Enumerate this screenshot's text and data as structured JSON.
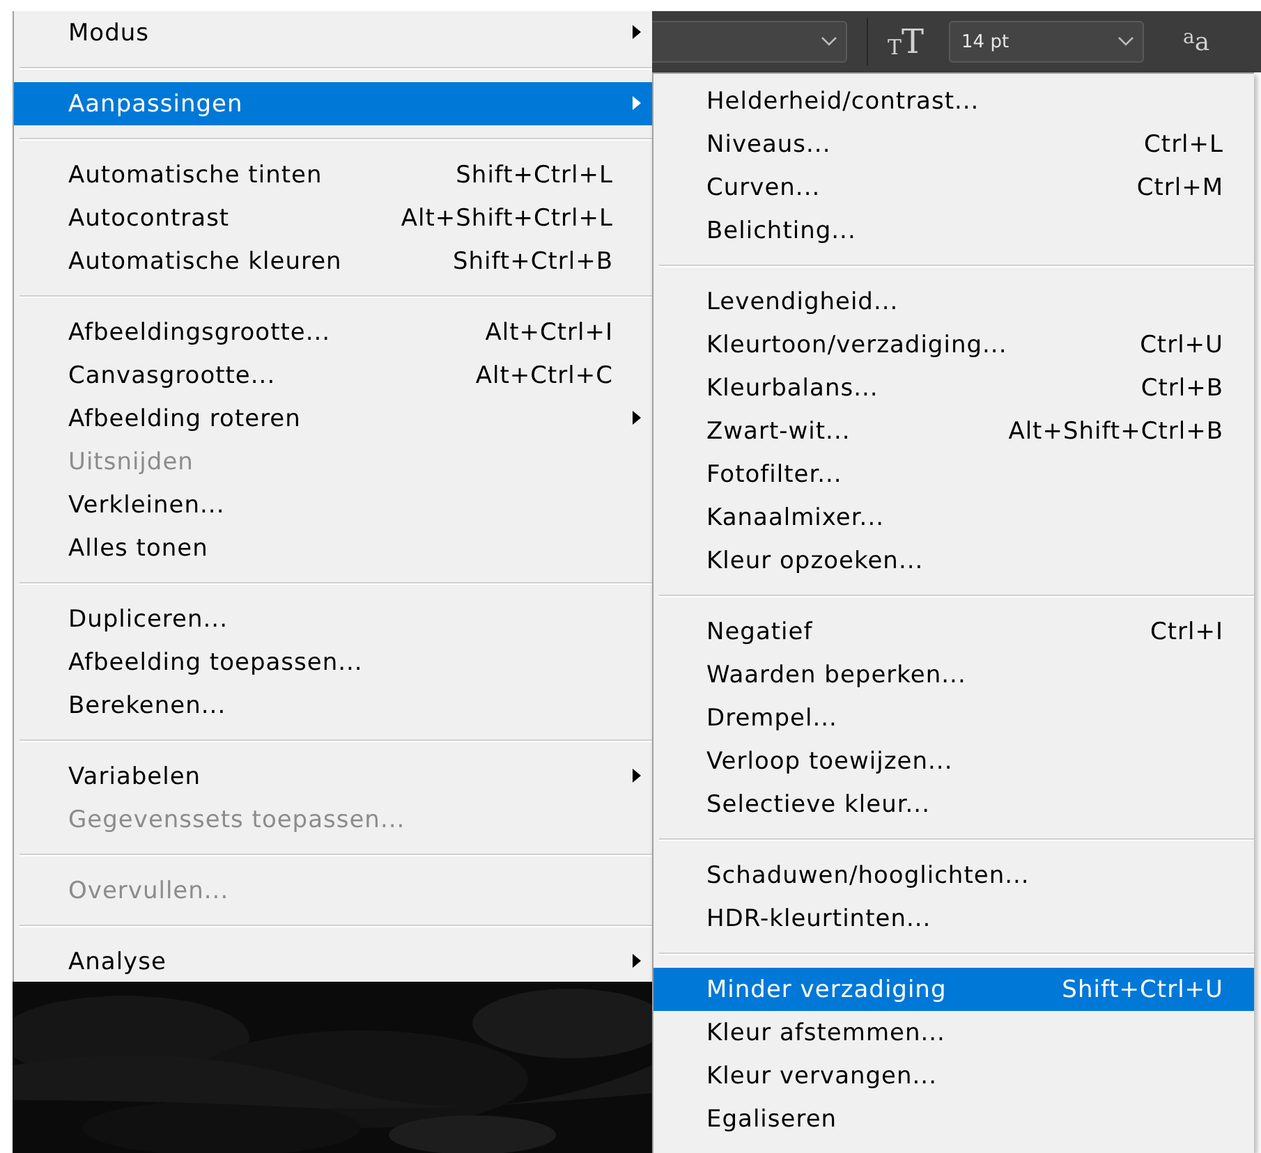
{
  "toolbar": {
    "size_icon": "$_{T}$T",
    "size_field": {
      "value": "14 pt"
    },
    "antialias_icon": "$^{a}$a"
  },
  "menu": {
    "sections": [
      [
        {
          "label": "Modus",
          "submenu": true,
          "disabled": false,
          "selected": false
        }
      ],
      [
        {
          "label": "Aanpassingen",
          "submenu": true,
          "disabled": false,
          "selected": true
        }
      ],
      [
        {
          "label": "Automatische tinten",
          "shortcut": "Shift+Ctrl+L",
          "submenu": false,
          "disabled": false,
          "selected": false
        },
        {
          "label": "Autocontrast",
          "shortcut": "Alt+Shift+Ctrl+L",
          "submenu": false,
          "disabled": false,
          "selected": false
        },
        {
          "label": "Automatische kleuren",
          "shortcut": "Shift+Ctrl+B",
          "submenu": false,
          "disabled": false,
          "selected": false
        }
      ],
      [
        {
          "label": "Afbeeldingsgrootte...",
          "shortcut": "Alt+Ctrl+I",
          "submenu": false,
          "disabled": false,
          "selected": false
        },
        {
          "label": "Canvasgrootte...",
          "shortcut": "Alt+Ctrl+C",
          "submenu": false,
          "disabled": false,
          "selected": false
        },
        {
          "label": "Afbeelding roteren",
          "submenu": true,
          "disabled": false,
          "selected": false
        },
        {
          "label": "Uitsnijden",
          "submenu": false,
          "disabled": true,
          "selected": false
        },
        {
          "label": "Verkleinen...",
          "submenu": false,
          "disabled": false,
          "selected": false
        },
        {
          "label": "Alles tonen",
          "submenu": false,
          "disabled": false,
          "selected": false
        }
      ],
      [
        {
          "label": "Dupliceren...",
          "submenu": false,
          "disabled": false,
          "selected": false
        },
        {
          "label": "Afbeelding toepassen...",
          "submenu": false,
          "disabled": false,
          "selected": false
        },
        {
          "label": "Berekenen...",
          "submenu": false,
          "disabled": false,
          "selected": false
        }
      ],
      [
        {
          "label": "Variabelen",
          "submenu": true,
          "disabled": false,
          "selected": false
        },
        {
          "label": "Gegevenssets toepassen...",
          "submenu": false,
          "disabled": true,
          "selected": false
        }
      ],
      [
        {
          "label": "Overvullen...",
          "submenu": false,
          "disabled": true,
          "selected": false
        }
      ],
      [
        {
          "label": "Analyse",
          "submenu": true,
          "disabled": false,
          "selected": false
        }
      ]
    ]
  },
  "submenu": {
    "sections": [
      [
        {
          "label": "Helderheid/contrast...",
          "selected": false
        },
        {
          "label": "Niveaus...",
          "shortcut": "Ctrl+L",
          "selected": false
        },
        {
          "label": "Curven...",
          "shortcut": "Ctrl+M",
          "selected": false
        },
        {
          "label": "Belichting...",
          "selected": false
        }
      ],
      [
        {
          "label": "Levendigheid...",
          "selected": false
        },
        {
          "label": "Kleurtoon/verzadiging...",
          "shortcut": "Ctrl+U",
          "selected": false
        },
        {
          "label": "Kleurbalans...",
          "shortcut": "Ctrl+B",
          "selected": false
        },
        {
          "label": "Zwart-wit...",
          "shortcut": "Alt+Shift+Ctrl+B",
          "selected": false
        },
        {
          "label": "Fotofilter...",
          "selected": false
        },
        {
          "label": "Kanaalmixer...",
          "selected": false
        },
        {
          "label": "Kleur opzoeken...",
          "selected": false
        }
      ],
      [
        {
          "label": "Negatief",
          "shortcut": "Ctrl+I",
          "selected": false
        },
        {
          "label": "Waarden beperken...",
          "selected": false
        },
        {
          "label": "Drempel...",
          "selected": false
        },
        {
          "label": "Verloop toewijzen...",
          "selected": false
        },
        {
          "label": "Selectieve kleur...",
          "selected": false
        }
      ],
      [
        {
          "label": "Schaduwen/hooglichten...",
          "selected": false
        },
        {
          "label": "HDR-kleurtinten...",
          "selected": false
        }
      ],
      [
        {
          "label": "Minder verzadiging",
          "shortcut": "Shift+Ctrl+U",
          "selected": true
        },
        {
          "label": "Kleur afstemmen...",
          "selected": false
        },
        {
          "label": "Kleur vervangen...",
          "selected": false
        },
        {
          "label": "Egaliseren",
          "selected": false
        }
      ]
    ]
  }
}
